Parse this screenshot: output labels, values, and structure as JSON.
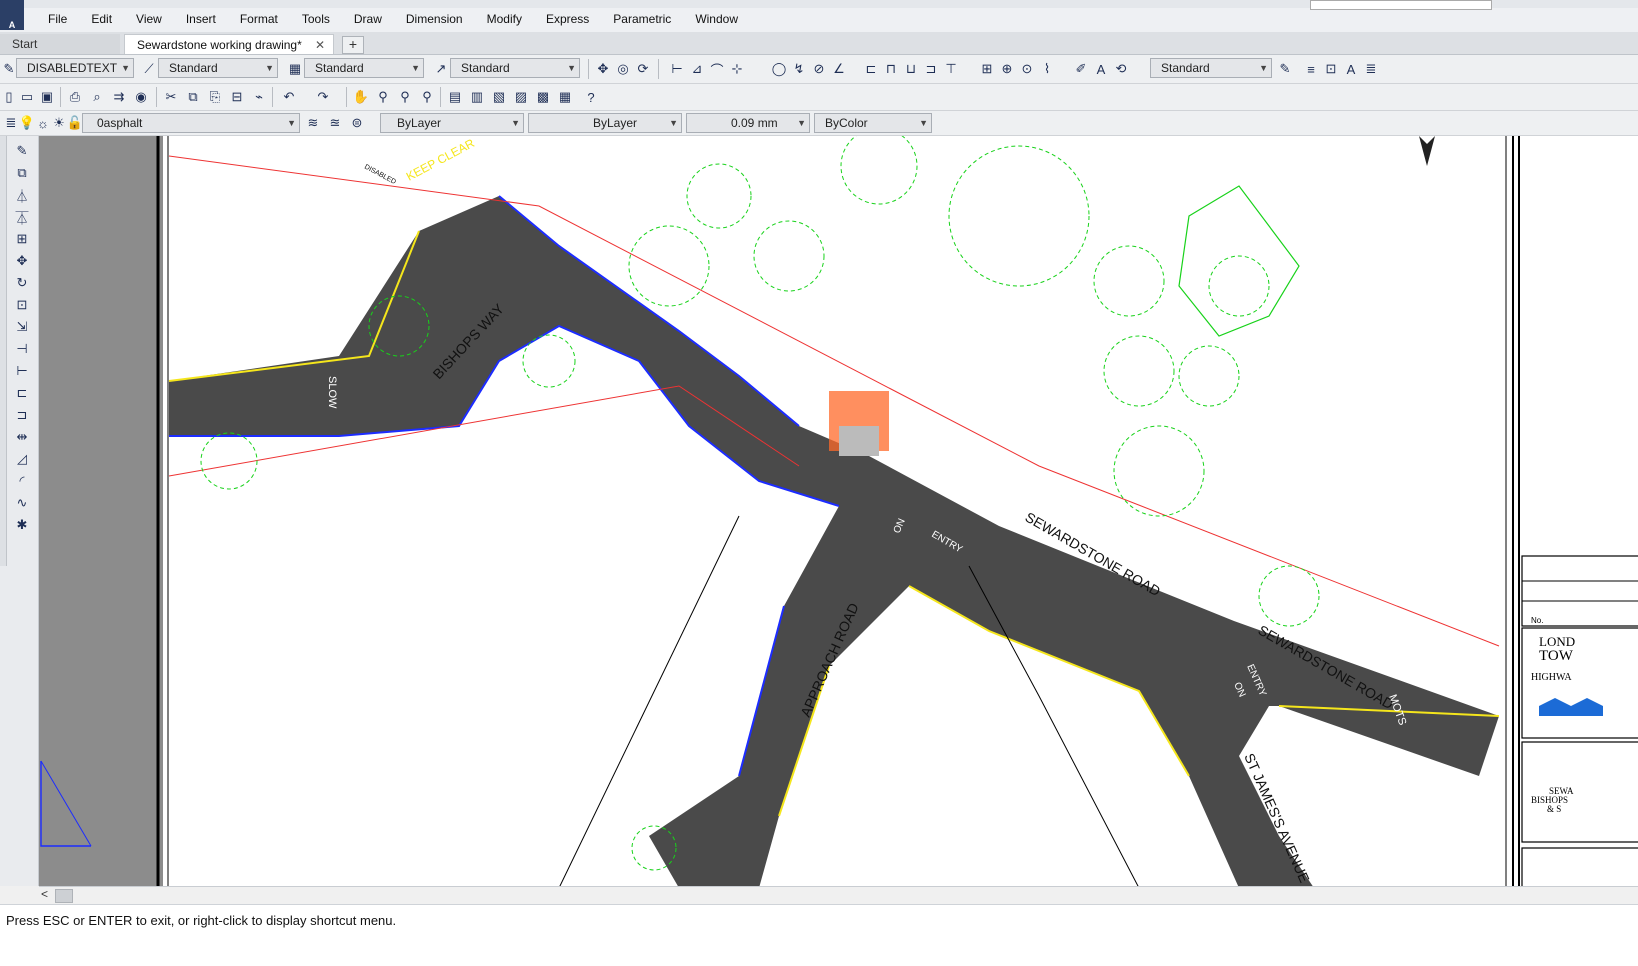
{
  "app": {
    "badge": "A"
  },
  "menu": [
    "File",
    "Edit",
    "View",
    "Insert",
    "Format",
    "Tools",
    "Draw",
    "Dimension",
    "Modify",
    "Express",
    "Parametric",
    "Window"
  ],
  "tabs": {
    "start": "Start",
    "active": "Sewardstone working drawing*",
    "close": "✕",
    "add": "+"
  },
  "styles": {
    "text_style": "DISABLEDTEXT",
    "dim_style": "Standard",
    "table_style": "Standard",
    "mleader_style": "Standard",
    "visual_style": "Standard"
  },
  "layers": {
    "current_layer": "0asphalt",
    "color": "ByLayer",
    "linetype": "ByLayer",
    "lineweight": "0.09 mm",
    "plotstyle": "ByColor"
  },
  "drawing": {
    "road_labels": [
      "BISHOPS WAY",
      "SEWARDSTONE ROAD",
      "SEWARDSTONE ROAD",
      "APPROACH ROAD",
      "ST JAMES'S AVENUE"
    ],
    "markings": [
      "KEEP CLEAR",
      "SLOW",
      "DISABLED",
      "ENTRY",
      "ENTRY",
      "ON",
      "ON",
      "MOTS"
    ],
    "titleblock": [
      "No.",
      "LOND",
      "TOW",
      "HIGHWA",
      "SEWA",
      "BISHOPS",
      "& S"
    ]
  },
  "statusbar": {
    "prompt": "Press ESC or ENTER to exit, or right-click to display shortcut menu."
  },
  "colors": {
    "asphalt": "#4a4a4a",
    "tree": "#18d21a",
    "kerb": "#1c2cff",
    "edge": "#f5e61c",
    "crossing": "#ff6a2a",
    "label": "#ff2d8a"
  }
}
